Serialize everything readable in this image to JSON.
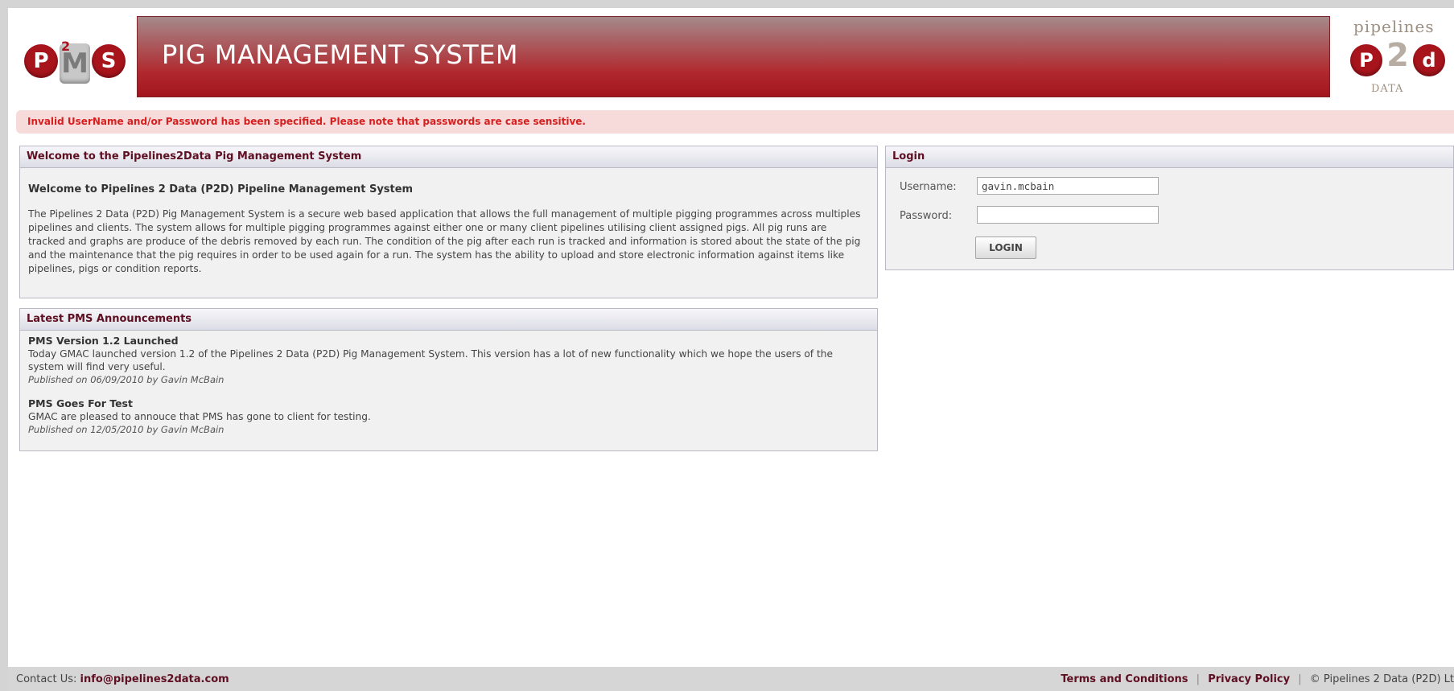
{
  "header": {
    "pms_logo_text": [
      "P",
      "M",
      "S"
    ],
    "pms_logo_sup": "2",
    "title": "PIG MANAGEMENT SYSTEM",
    "p2d_logo": {
      "top": "pipelines",
      "left": "P",
      "mid": "2",
      "right": "d",
      "bottom": "DATA"
    }
  },
  "error": {
    "message": "Invalid UserName and/or Password has been specified. Please note that passwords are case sensitive."
  },
  "welcome": {
    "panel_title": "Welcome to the Pipelines2Data Pig Management System",
    "subtitle": "Welcome to Pipelines 2 Data (P2D) Pipeline Management System",
    "body": "The Pipelines 2 Data (P2D) Pig Management System is a secure web based application that allows the full management of multiple pigging programmes across multiples pipelines and clients. The system allows for multiple pigging programmes against either one or many client pipelines utilising client assigned pigs. All pig runs are tracked and graphs are produce of the debris removed by each run. The condition of the pig after each run is tracked and information is stored about the state of the pig and the maintenance that the pig requires in order to be used again for a run. The system has the ability to upload and store electronic information against items like pipelines, pigs or condition reports."
  },
  "announcements": {
    "panel_title": "Latest PMS Announcements",
    "items": [
      {
        "title": "PMS Version 1.2 Launched",
        "body": "Today GMAC launched version 1.2 of the Pipelines 2 Data (P2D) Pig Management System. This version has a lot of new functionality which we hope the users of the system will find very useful.",
        "published": "Published on 06/09/2010 by Gavin McBain"
      },
      {
        "title": "PMS Goes For Test",
        "body": "GMAC are pleased to annouce that PMS has gone to client for testing.",
        "published": "Published on 12/05/2010 by Gavin McBain"
      }
    ]
  },
  "login": {
    "panel_title": "Login",
    "username_label": "Username:",
    "username_value": "gavin.mcbain",
    "password_label": "Password:",
    "password_value": "",
    "button_label": "LOGIN"
  },
  "footer": {
    "contact_label": "Contact Us:",
    "contact_email": "info@pipelines2data.com",
    "terms": "Terms and Conditions",
    "sep": "|",
    "privacy": "Privacy Policy",
    "copyright": "© Pipelines 2 Data (P2D) Lt"
  }
}
